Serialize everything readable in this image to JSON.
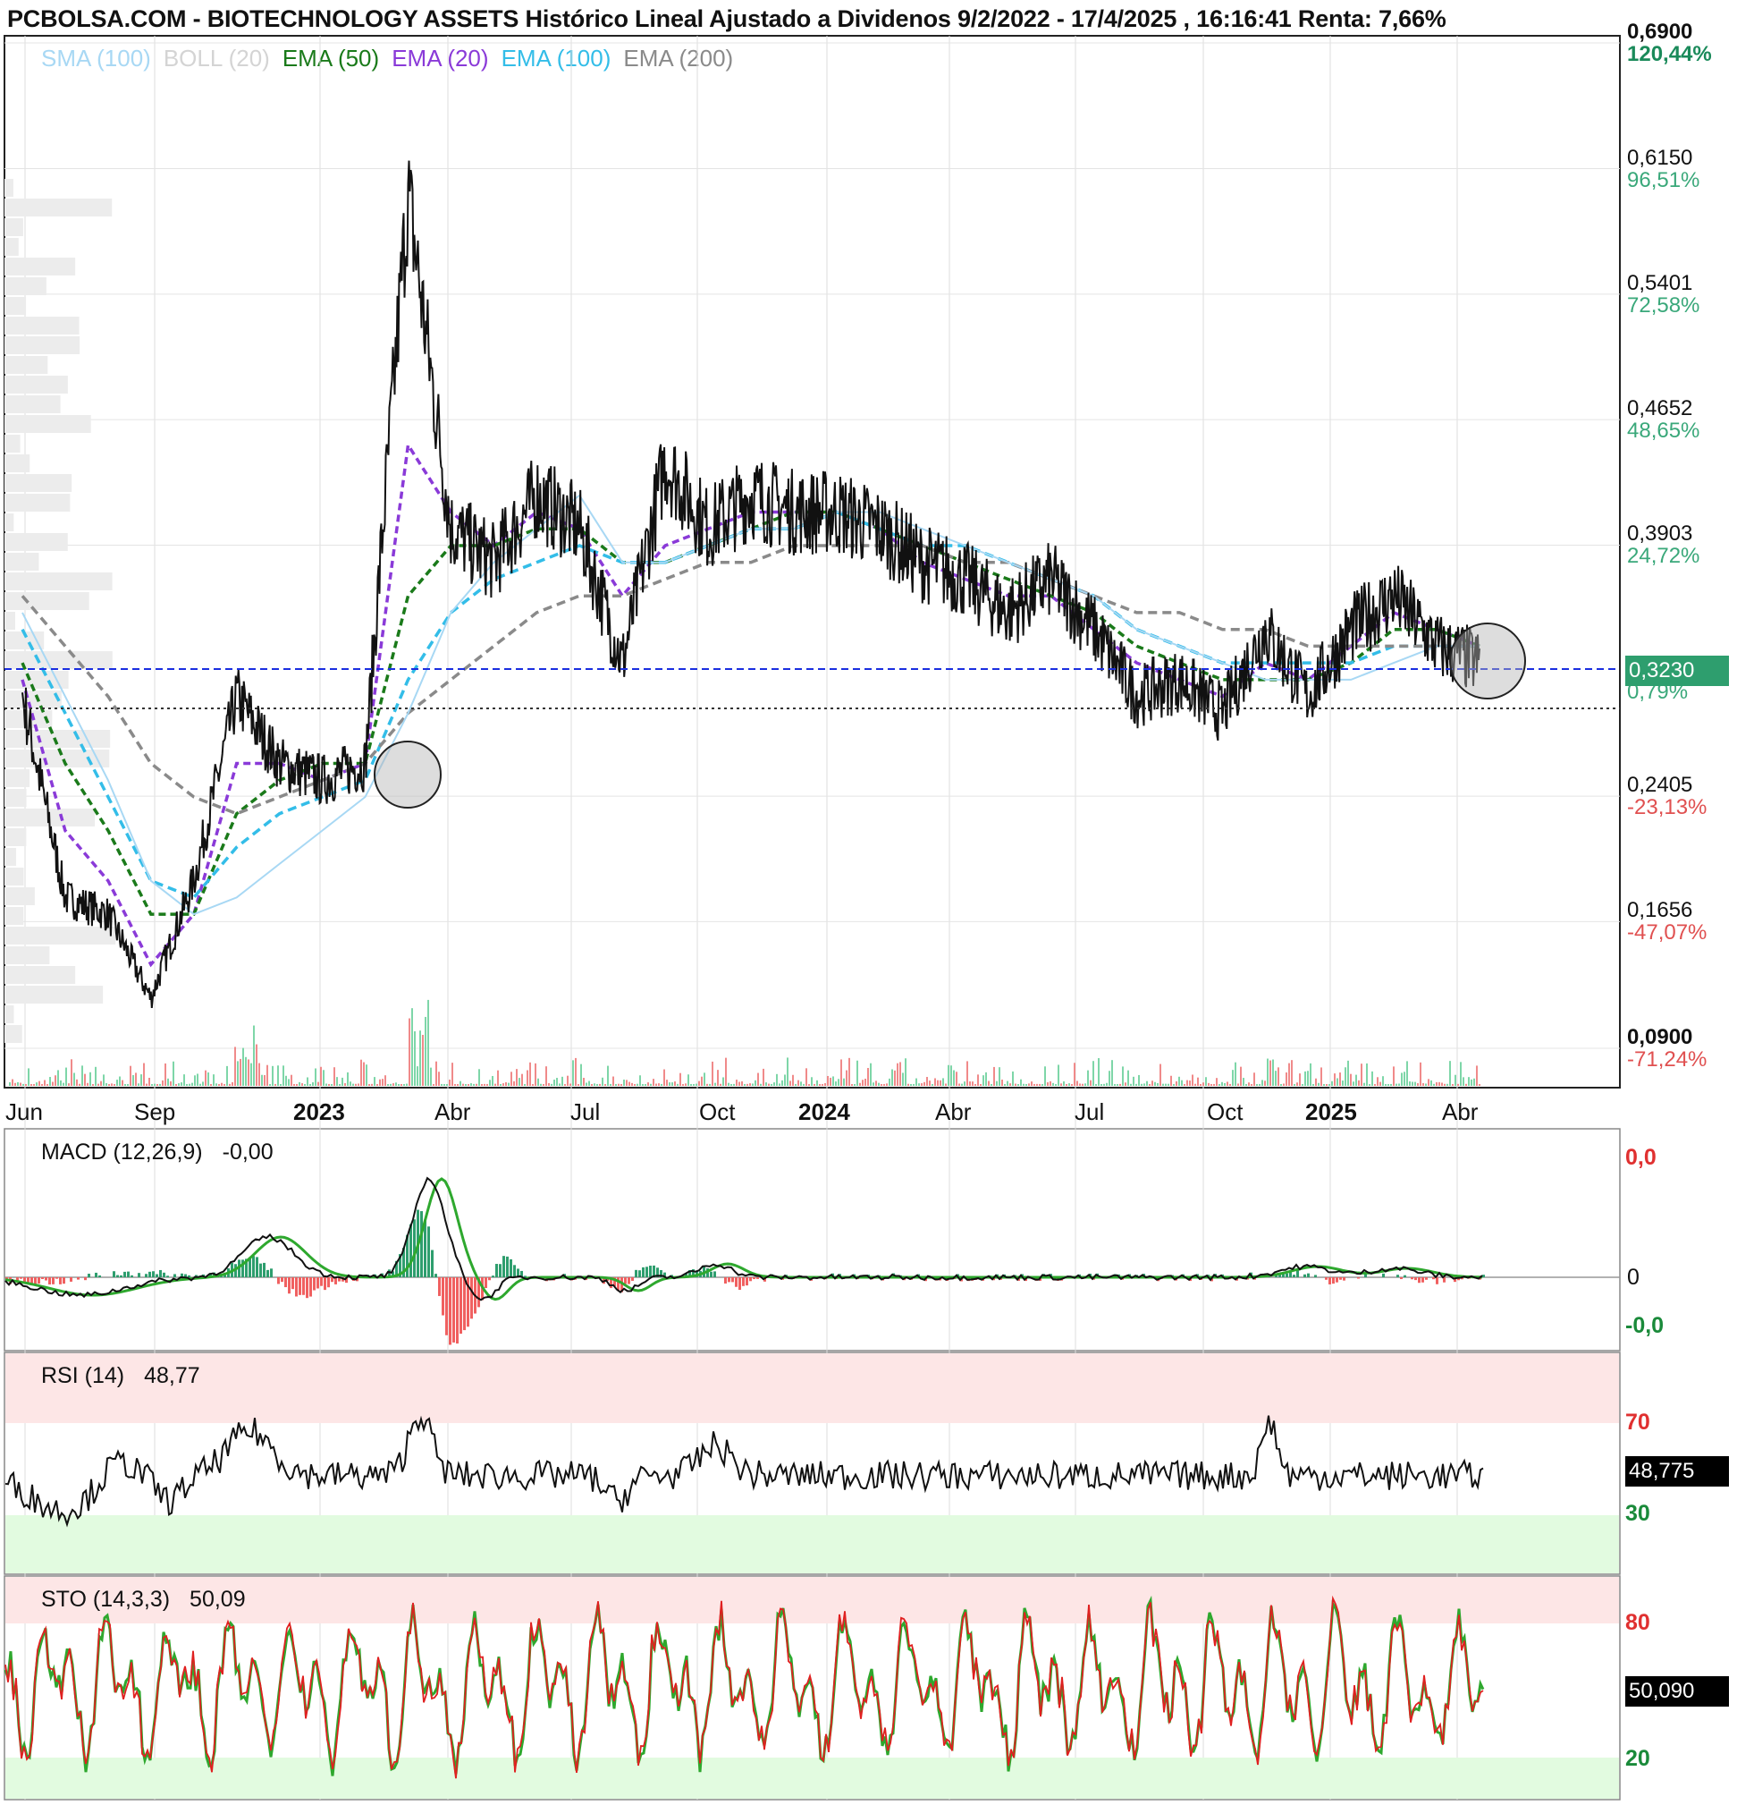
{
  "header": {
    "title": "PCBOLSA.COM - BIOTECHNOLOGY ASSETS Histórico Lineal Ajustado a Dividenos 9/2/2022 - 17/4/2025 , 16:16:41 Renta: 7,66%"
  },
  "legend": [
    {
      "label": "SMA (100)",
      "color": "#a8d8f4"
    },
    {
      "label": "BOLL (20)",
      "color": "#d4d4d4"
    },
    {
      "label": "EMA (50)",
      "color": "#1a7a1a"
    },
    {
      "label": "EMA (20)",
      "color": "#8a3ad8"
    },
    {
      "label": "EMA (100)",
      "color": "#33bde8"
    },
    {
      "label": "EMA (200)",
      "color": "#8a8a8a"
    }
  ],
  "price_axis": [
    {
      "price": "0,6900",
      "pct": "120,44%",
      "color": "#1a8a5a"
    },
    {
      "price": "0,6150",
      "pct": "96,51%",
      "color": "#3aa87a"
    },
    {
      "price": "0,5401",
      "pct": "72,58%",
      "color": "#3aa87a"
    },
    {
      "price": "0,4652",
      "pct": "48,65%",
      "color": "#3aa87a"
    },
    {
      "price": "0,3903",
      "pct": "24,72%",
      "color": "#3aa87a"
    },
    {
      "price": "0,3230",
      "pct": "0,79%",
      "color": "#3aa87a"
    },
    {
      "price": "0,2405",
      "pct": "-23,13%",
      "color": "#e05050"
    },
    {
      "price": "0,1656",
      "pct": "-47,07%",
      "color": "#e05050"
    },
    {
      "price": "0,0900",
      "pct": "-71,24%",
      "color": "#e05050"
    }
  ],
  "x_labels": [
    {
      "text": "Jun",
      "bold": false
    },
    {
      "text": "Sep",
      "bold": false
    },
    {
      "text": "2023",
      "bold": true
    },
    {
      "text": "Abr",
      "bold": false
    },
    {
      "text": "Jul",
      "bold": false
    },
    {
      "text": "Oct",
      "bold": false
    },
    {
      "text": "2024",
      "bold": true
    },
    {
      "text": "Abr",
      "bold": false
    },
    {
      "text": "Jul",
      "bold": false
    },
    {
      "text": "Oct",
      "bold": false
    },
    {
      "text": "2025",
      "bold": true
    },
    {
      "text": "Abr",
      "bold": false
    }
  ],
  "current_price": {
    "value": "0,3230",
    "color": "#2e9e6e"
  },
  "macd": {
    "label": "MACD (12,26,9)",
    "value": "-0,00",
    "axis_top": "0,0",
    "axis_mid": "0",
    "axis_bottom": "-0,0"
  },
  "rsi": {
    "label": "RSI (14)",
    "value": "48,77",
    "upper": "70",
    "lower": "30",
    "box": "48,775"
  },
  "sto": {
    "label": "STO (14,3,3)",
    "value": "50,09",
    "upper": "80",
    "lower": "20",
    "box": "50,090"
  },
  "chart_data": {
    "type": "line",
    "title": "PCBOLSA.COM - BIOTECHNOLOGY ASSETS Histórico Lineal Ajustado a Dividenos 9/2/2022 - 17/4/2025 , 16:16:41 Renta: 7,66%",
    "x": [
      "2022-06",
      "2022-07",
      "2022-08",
      "2022-09",
      "2022-10",
      "2022-11",
      "2022-12",
      "2023-01",
      "2023-02",
      "2023-03",
      "2023-04",
      "2023-05",
      "2023-06",
      "2023-07",
      "2023-08",
      "2023-09",
      "2023-10",
      "2023-11",
      "2023-12",
      "2024-01",
      "2024-02",
      "2024-03",
      "2024-04",
      "2024-05",
      "2024-06",
      "2024-07",
      "2024-08",
      "2024-09",
      "2024-10",
      "2024-11",
      "2024-12",
      "2025-01",
      "2025-02",
      "2025-03",
      "2025-04"
    ],
    "series": [
      {
        "name": "Close",
        "values": [
          0.3,
          0.18,
          0.17,
          0.12,
          0.19,
          0.3,
          0.26,
          0.25,
          0.26,
          0.6,
          0.4,
          0.38,
          0.42,
          0.4,
          0.32,
          0.44,
          0.4,
          0.42,
          0.41,
          0.41,
          0.4,
          0.38,
          0.37,
          0.35,
          0.37,
          0.34,
          0.3,
          0.31,
          0.29,
          0.34,
          0.3,
          0.34,
          0.36,
          0.33,
          0.32
        ]
      },
      {
        "name": "EMA (20)",
        "values": [
          0.31,
          0.22,
          0.19,
          0.14,
          0.17,
          0.26,
          0.26,
          0.25,
          0.26,
          0.45,
          0.41,
          0.39,
          0.41,
          0.4,
          0.36,
          0.39,
          0.4,
          0.41,
          0.41,
          0.41,
          0.4,
          0.38,
          0.37,
          0.36,
          0.36,
          0.34,
          0.32,
          0.31,
          0.3,
          0.32,
          0.31,
          0.33,
          0.35,
          0.34,
          0.33
        ]
      },
      {
        "name": "EMA (50)",
        "values": [
          0.32,
          0.26,
          0.22,
          0.17,
          0.17,
          0.23,
          0.25,
          0.26,
          0.26,
          0.36,
          0.39,
          0.39,
          0.4,
          0.4,
          0.38,
          0.38,
          0.39,
          0.4,
          0.41,
          0.41,
          0.4,
          0.39,
          0.38,
          0.37,
          0.36,
          0.35,
          0.33,
          0.32,
          0.31,
          0.31,
          0.31,
          0.32,
          0.34,
          0.34,
          0.33
        ]
      },
      {
        "name": "EMA (100)",
        "values": [
          0.34,
          0.29,
          0.24,
          0.19,
          0.18,
          0.21,
          0.23,
          0.24,
          0.25,
          0.31,
          0.35,
          0.37,
          0.38,
          0.39,
          0.38,
          0.38,
          0.39,
          0.4,
          0.4,
          0.41,
          0.4,
          0.39,
          0.39,
          0.38,
          0.37,
          0.36,
          0.34,
          0.33,
          0.32,
          0.32,
          0.32,
          0.32,
          0.33,
          0.33,
          0.33
        ]
      },
      {
        "name": "EMA (200)",
        "values": [
          0.36,
          0.33,
          0.3,
          0.26,
          0.24,
          0.23,
          0.24,
          0.25,
          0.26,
          0.29,
          0.31,
          0.33,
          0.35,
          0.36,
          0.36,
          0.37,
          0.38,
          0.38,
          0.39,
          0.39,
          0.39,
          0.39,
          0.38,
          0.38,
          0.37,
          0.36,
          0.35,
          0.35,
          0.34,
          0.34,
          0.33,
          0.33,
          0.33,
          0.33,
          0.33
        ]
      },
      {
        "name": "SMA (100)",
        "values": [
          0.35,
          0.3,
          0.25,
          0.19,
          0.17,
          0.18,
          0.2,
          0.22,
          0.24,
          0.29,
          0.35,
          0.38,
          0.4,
          0.42,
          0.38,
          0.38,
          0.39,
          0.4,
          0.4,
          0.41,
          0.41,
          0.4,
          0.39,
          0.38,
          0.37,
          0.36,
          0.34,
          0.33,
          0.32,
          0.31,
          0.31,
          0.31,
          0.32,
          0.33,
          0.33
        ]
      }
    ],
    "ylim": [
      0.09,
      0.69
    ],
    "grid": true
  }
}
